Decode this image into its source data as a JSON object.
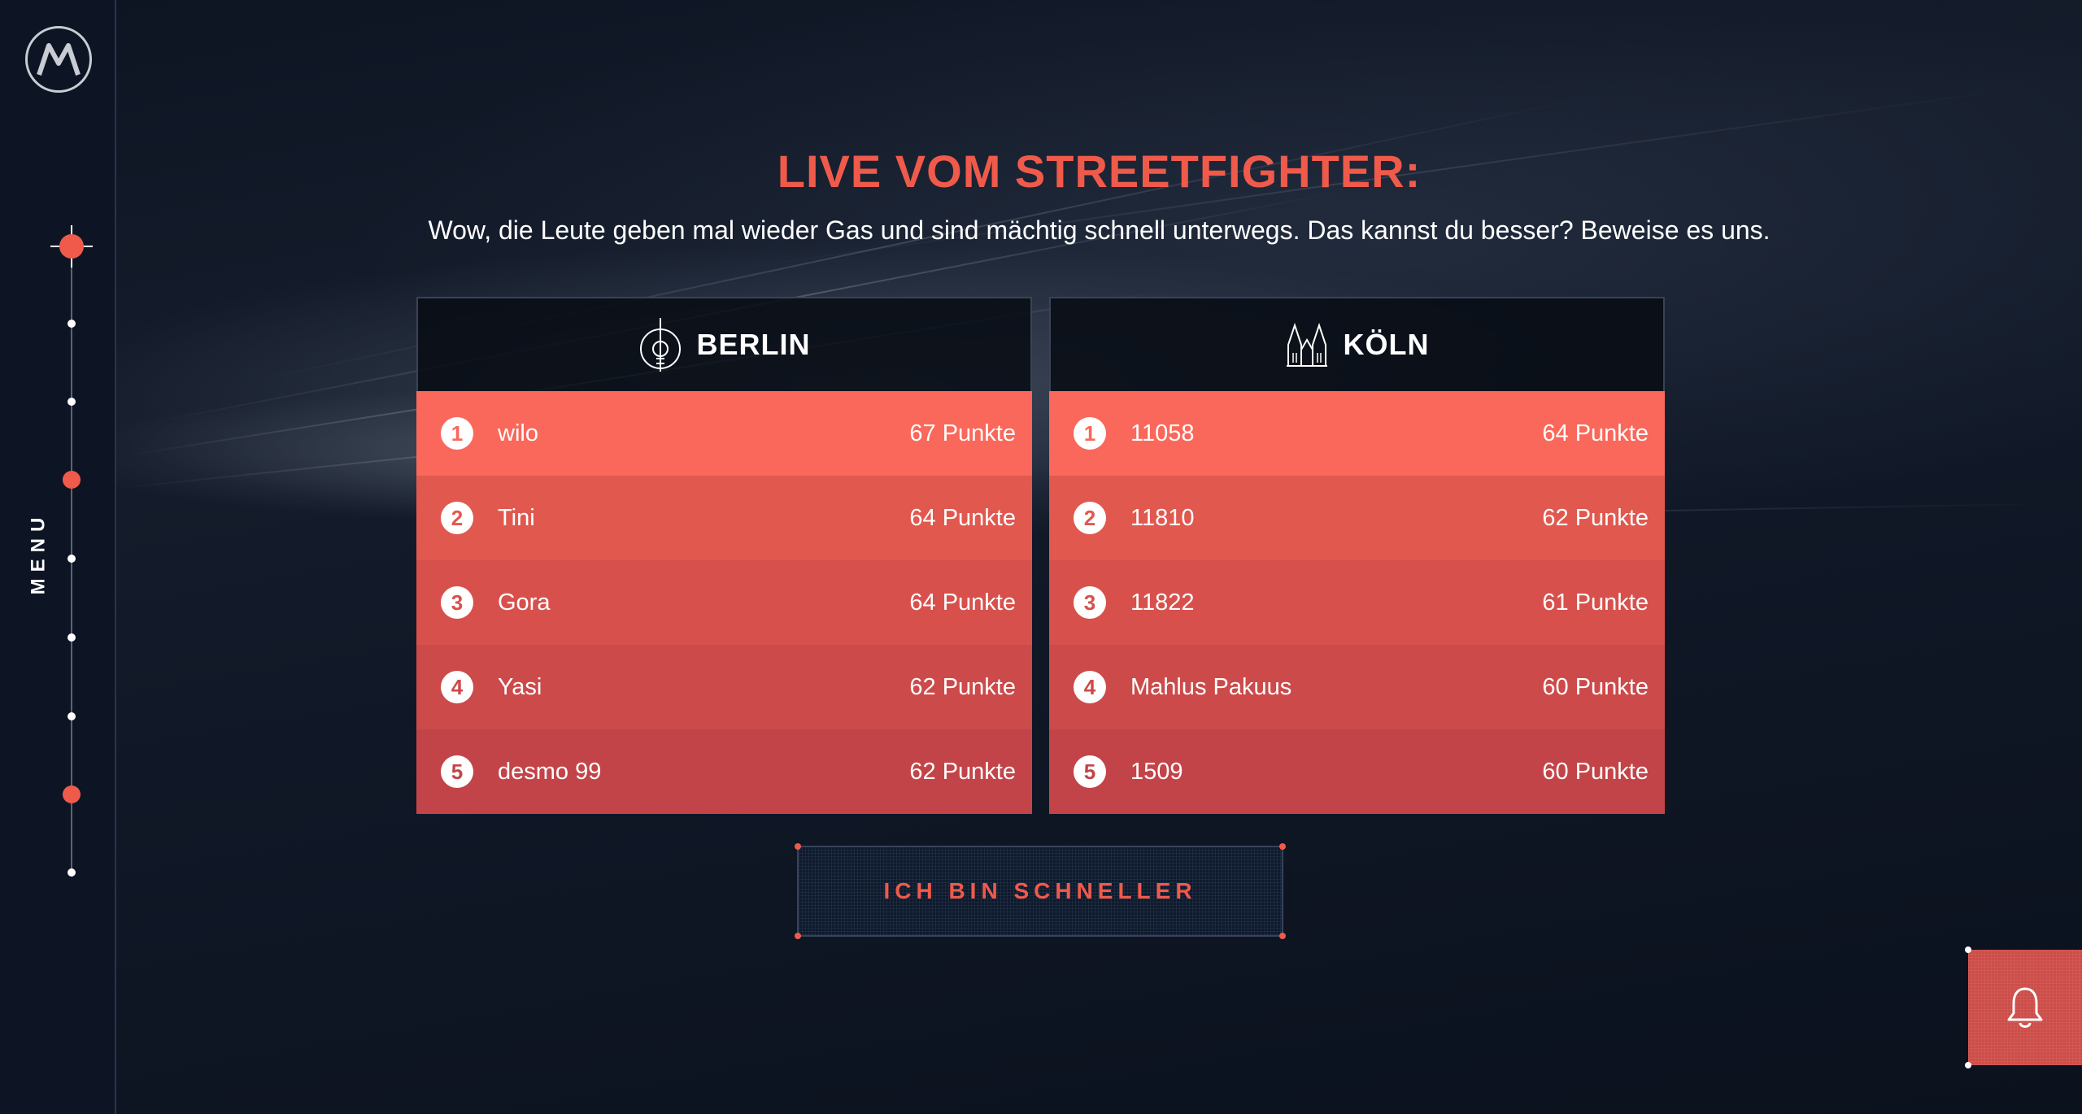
{
  "sidebar": {
    "logo": "motorola-logo",
    "menu_label": "MENU"
  },
  "header": {
    "title": "LIVE VOM STREETFIGHTER:",
    "subtitle": "Wow, die Leute geben mal wieder Gas und sind mächtig schnell unterwegs. Das kannst du besser? Beweise es uns."
  },
  "boards": [
    {
      "city": "BERLIN",
      "icon": "tv-tower-icon",
      "rows": [
        {
          "rank": "1",
          "name": "wilo",
          "points": "67 Punkte"
        },
        {
          "rank": "2",
          "name": "Tini",
          "points": "64 Punkte"
        },
        {
          "rank": "3",
          "name": "Gora",
          "points": "64 Punkte"
        },
        {
          "rank": "4",
          "name": "Yasi",
          "points": "62 Punkte"
        },
        {
          "rank": "5",
          "name": "desmo 99",
          "points": "62 Punkte"
        }
      ]
    },
    {
      "city": "KÖLN",
      "icon": "cathedral-icon",
      "rows": [
        {
          "rank": "1",
          "name": "11058",
          "points": "64 Punkte"
        },
        {
          "rank": "2",
          "name": "11810",
          "points": "62 Punkte"
        },
        {
          "rank": "3",
          "name": "11822",
          "points": "61 Punkte"
        },
        {
          "rank": "4",
          "name": "Mahlus Pakuus",
          "points": "60 Punkte"
        },
        {
          "rank": "5",
          "name": "1509",
          "points": "60 Punkte"
        }
      ]
    }
  ],
  "cta": {
    "label": "ICH BIN SCHNELLER"
  },
  "notification": {
    "icon": "bell-icon"
  },
  "colors": {
    "accent": "#f05a4b",
    "row1": "#f9685a",
    "row5": "#c34448",
    "background": "#0c1220"
  }
}
